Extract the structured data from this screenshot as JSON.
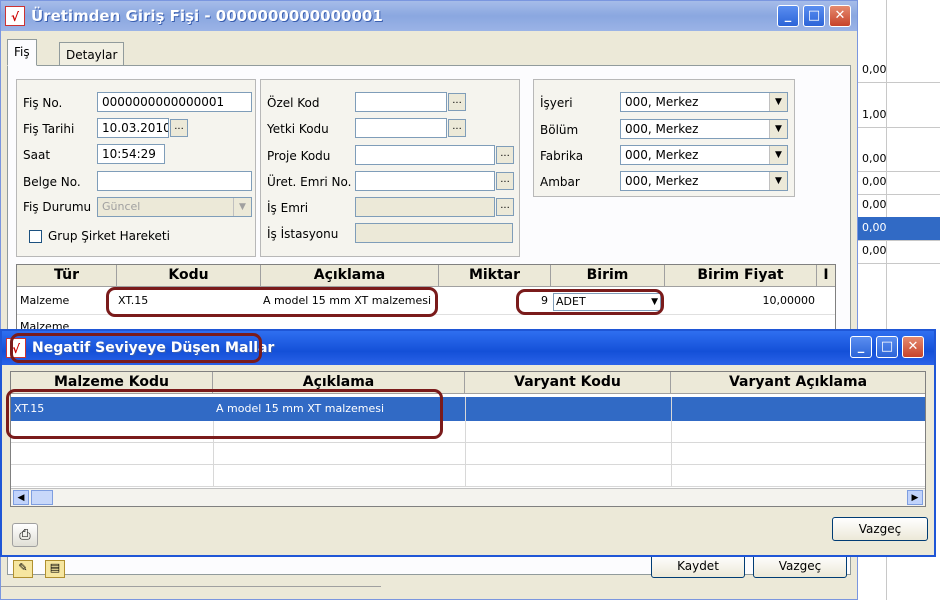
{
  "background_sheet": {
    "values": [
      "0,00",
      "1,00",
      "0,00",
      "0,00",
      "0,00",
      "0,00",
      "0,00"
    ]
  },
  "main_window": {
    "title": "Üretimden Giriş Fişi - 0000000000000001",
    "tabs": [
      {
        "label": "Fiş"
      },
      {
        "label": "Detaylar"
      }
    ],
    "left_group": {
      "fis_no": {
        "label": "Fiş No.",
        "value": "0000000000000001"
      },
      "fis_tarihi": {
        "label": "Fiş Tarihi",
        "value": "10.03.2010"
      },
      "saat": {
        "label": "Saat",
        "value": "10:54:29"
      },
      "belge_no": {
        "label": "Belge No.",
        "value": ""
      },
      "fis_durumu": {
        "label": "Fiş Durumu",
        "value": "Güncel"
      },
      "grup_sirket": {
        "label": "Grup Şirket Hareketi",
        "checked": false
      }
    },
    "middle_group": {
      "ozel_kod": {
        "label": "Özel Kod",
        "value": ""
      },
      "yetki_kodu": {
        "label": "Yetki Kodu",
        "value": ""
      },
      "proje_kodu": {
        "label": "Proje Kodu",
        "value": ""
      },
      "uret_emri_no": {
        "label": "Üret. Emri No.",
        "value": ""
      },
      "is_emri": {
        "label": "İş Emri",
        "value": ""
      },
      "is_istasyonu": {
        "label": "İş İstasyonu",
        "value": ""
      }
    },
    "right_group": {
      "isyeri": {
        "label": "İşyeri",
        "value": "000, Merkez"
      },
      "bolum": {
        "label": "Bölüm",
        "value": "000, Merkez"
      },
      "fabrika": {
        "label": "Fabrika",
        "value": "000, Merkez"
      },
      "ambar": {
        "label": "Ambar",
        "value": "000, Merkez"
      }
    },
    "grid": {
      "columns": [
        "Tür",
        "Kodu",
        "Açıklama",
        "Miktar",
        "Birim",
        "Birim Fiyat",
        "I"
      ],
      "rows": [
        {
          "tur": "Malzeme",
          "kodu": "XT.15",
          "aciklama": "A model  15 mm  XT malzemesi",
          "miktar": "9",
          "birim": "ADET",
          "birim_fiyat": "10,00000"
        },
        {
          "tur": "Malzeme",
          "kodu": "",
          "aciklama": "",
          "miktar": "",
          "birim": "",
          "birim_fiyat": ""
        }
      ]
    },
    "buttons": {
      "kaydet": "Kaydet",
      "vazgec": "Vazgeç"
    }
  },
  "popup": {
    "title": "Negatif Seviyeye Düşen Mallar",
    "columns": [
      "Malzeme Kodu",
      "Açıklama",
      "Varyant Kodu",
      "Varyant Açıklama"
    ],
    "rows": [
      {
        "malzeme_kodu": "XT.15",
        "aciklama": "A model  15 mm  XT malzemesi",
        "varyant_kodu": "",
        "varyant_aciklama": ""
      }
    ],
    "button_vazgec": "Vazgeç"
  },
  "colors": {
    "selection": "#316ac5",
    "highlight_ring": "#7a1b1b",
    "xp_title_active": "#1450d8",
    "xp_title_inactive": "#8aa7e0"
  }
}
